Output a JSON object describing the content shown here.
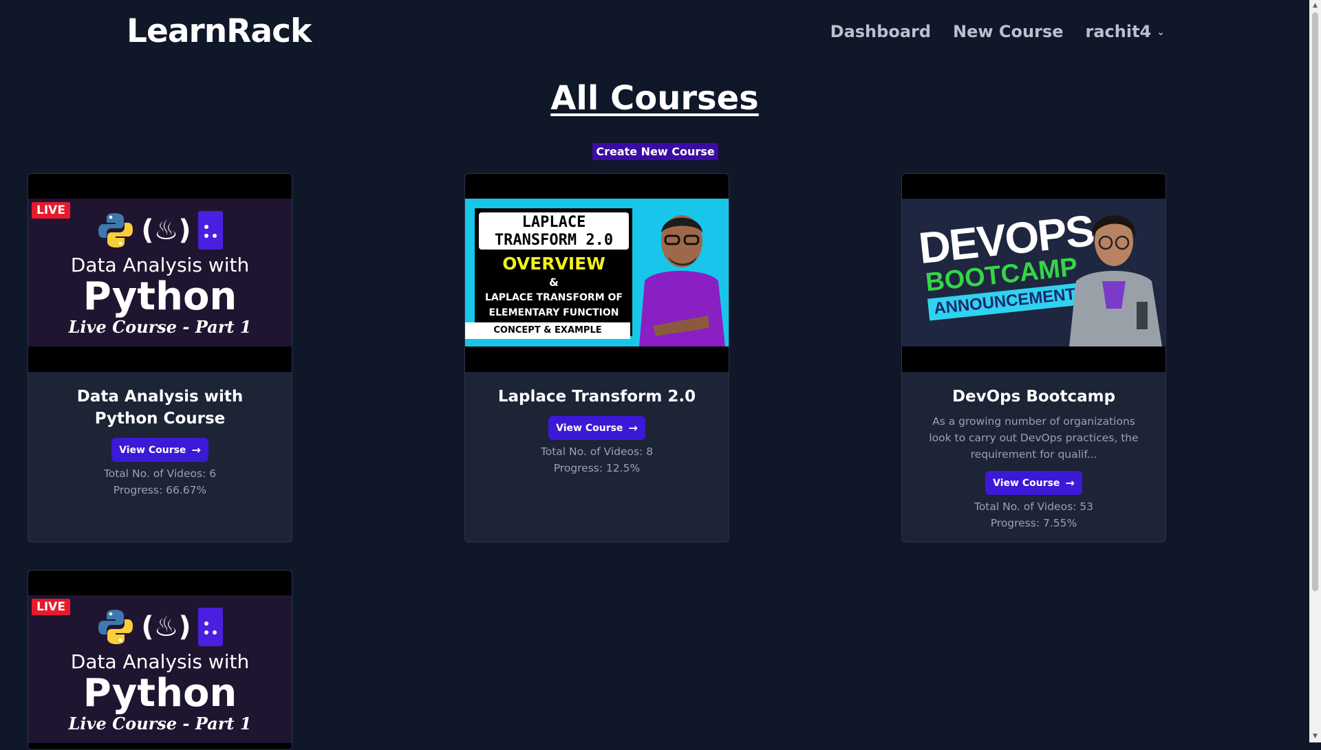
{
  "header": {
    "brand": "LearnRack",
    "nav": [
      "Dashboard",
      "New Course"
    ],
    "user": "rachit4"
  },
  "main": {
    "title": "All Courses",
    "create_button": "Create New Course"
  },
  "thumbnails": {
    "python": {
      "live": "LIVE",
      "line1": "Data  Analysis with",
      "line2": "Python",
      "line3": "Live Course - Part 1"
    },
    "laplace": {
      "box_line1": "LAPLACE",
      "box_line2": "TRANSFORM 2.0",
      "overview": "OVERVIEW",
      "amp": "&",
      "sub_line1": "LAPLACE TRANSFORM OF",
      "sub_line2": "ELEMENTARY FUNCTION",
      "strip": "CONCEPT & EXAMPLE"
    },
    "devops": {
      "line1": "DEVOPS",
      "line2": "BOOTCAMP",
      "line3": "ANNOUNCEMENT"
    }
  },
  "courses": [
    {
      "title": "Data Analysis with Python Course",
      "description": "",
      "button": "View Course",
      "videos": "Total No. of Videos: 6",
      "progress": "Progress: 66.67%"
    },
    {
      "title": "Laplace Transform 2.0",
      "description": "",
      "button": "View Course",
      "videos": "Total No. of Videos: 8",
      "progress": "Progress: 12.5%"
    },
    {
      "title": "DevOps Bootcamp",
      "description": "As a growing number of organizations look to carry out DevOps practices, the requirement for qualif...",
      "button": "View Course",
      "videos": "Total No. of Videos: 53",
      "progress": "Progress: 7.55%"
    }
  ],
  "colors": {
    "background": "#0f1729",
    "card": "#1c2436",
    "button": "#3b19d6",
    "create_button": "#3a0ca3",
    "live_badge": "#e8192c"
  }
}
